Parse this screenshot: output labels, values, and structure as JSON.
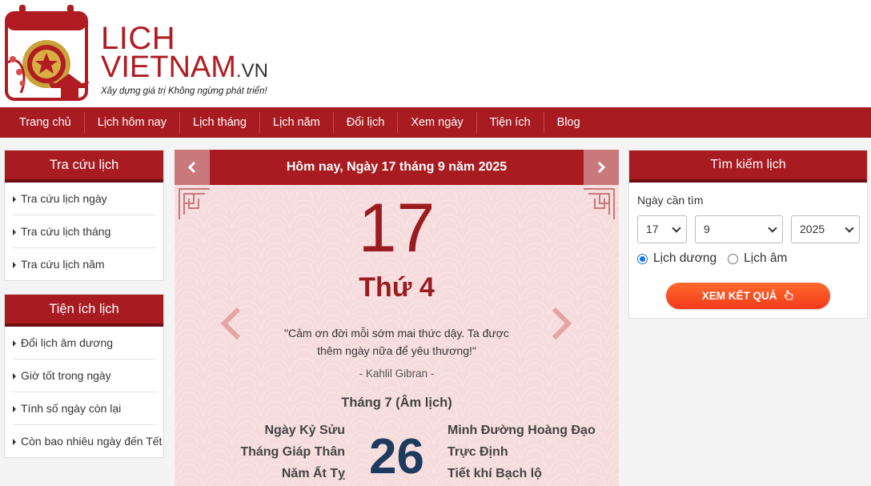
{
  "brand": {
    "name_line1": "LICH",
    "name_line2": "VIETNAM",
    "domain": ".VN",
    "slogan": "Xây dựng giá trị Không ngừng phát triển!"
  },
  "nav": {
    "items": [
      "Trang chủ",
      "Lịch hôm nay",
      "Lịch tháng",
      "Lịch năm",
      "Đổi lịch",
      "Xem ngày",
      "Tiện ích",
      "Blog"
    ]
  },
  "lookup_box": {
    "title": "Tra cứu lịch",
    "items": [
      "Tra cứu lịch ngày",
      "Tra cứu lịch tháng",
      "Tra cứu lịch năm"
    ]
  },
  "utility_box": {
    "title": "Tiện ích lịch",
    "items": [
      "Đổi lịch âm dương",
      "Giờ tốt trong ngày",
      "Tính số ngày còn lại",
      "Còn bao nhiêu ngày đến Tết"
    ]
  },
  "calendar": {
    "header_title": "Hôm nay, Ngày 17 tháng 9 năm 2025",
    "day": "17",
    "weekday": "Thứ 4",
    "quote": "\"Cảm ơn đời mỗi sớm mai thức dậy. Ta được thêm ngày nữa để yêu thương!\"",
    "quote_author": "- Kahlil Gibran -",
    "lunar_month": "Tháng 7 (Âm lịch)",
    "lunar_day_name": "Ngày Kỷ Sửu",
    "lunar_month_name": "Tháng Giáp Thân",
    "lunar_year_name": "Năm Ất Tỵ",
    "lunar_day": "26",
    "day_quality": "Minh Đường Hoàng Đạo",
    "truc": "Trực Định",
    "solar_term": "Tiết khí Bạch lộ"
  },
  "search_box": {
    "title": "Tìm kiếm lịch",
    "label": "Ngày cần tìm",
    "day": "17",
    "month": "9",
    "year": "2025",
    "radio_solar": "Lịch dương",
    "radio_lunar": "Lịch âm",
    "selected": "solar",
    "submit_label": "XEM KẾT QUẢ"
  },
  "colors": {
    "primary_red": "#a81c21",
    "calendar_bg": "#f6dcdc",
    "lunar_day_blue": "#1e3a5f",
    "button_orange": "#f23b1c"
  }
}
